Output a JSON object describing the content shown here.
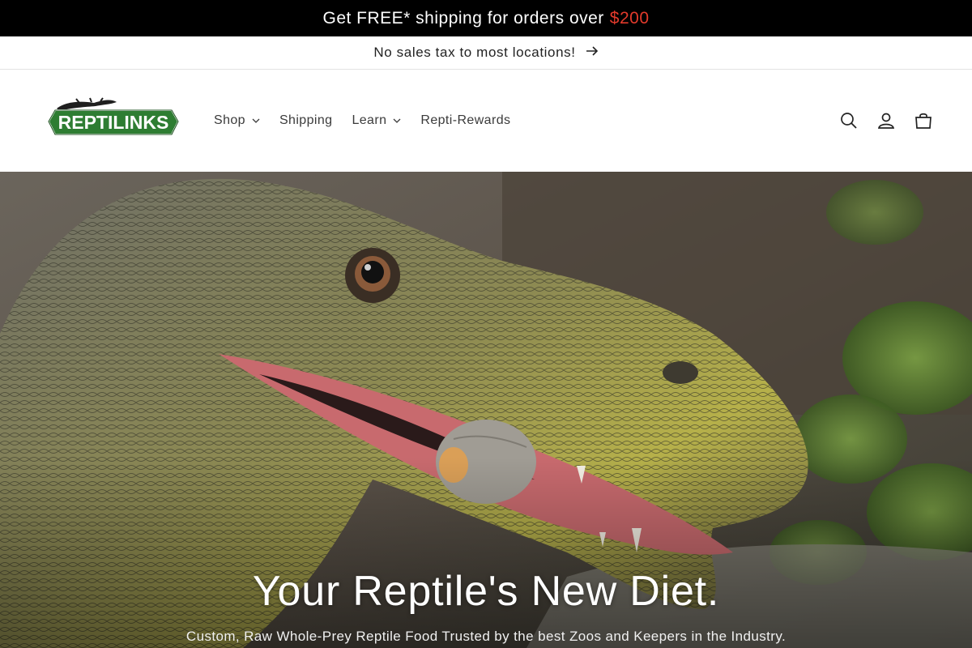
{
  "promo": {
    "text": "Get FREE* shipping for orders over",
    "price": "$200",
    "price_color": "#e23a2b"
  },
  "announcement": {
    "text": "No sales tax to most locations!",
    "arrow_icon": "arrow-right-icon"
  },
  "logo": {
    "text": "REPTILINKS",
    "brand_color": "#2e7d32"
  },
  "nav": [
    {
      "label": "Shop",
      "dropdown": true
    },
    {
      "label": "Shipping",
      "dropdown": false
    },
    {
      "label": "Learn",
      "dropdown": true
    },
    {
      "label": "Repti-Rewards",
      "dropdown": false
    }
  ],
  "header_icons": [
    "search-icon",
    "account-icon",
    "cart-icon"
  ],
  "hero": {
    "title": "Your Reptile's New Diet.",
    "subtitle": "Custom, Raw Whole-Prey Reptile Food Trusted by the best Zoos and Keepers in the Industry."
  }
}
